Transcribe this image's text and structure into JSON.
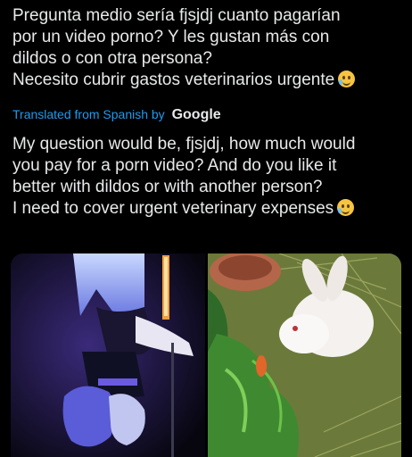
{
  "tweet": {
    "original_lines": [
      "Pregunta medio sería fjsjdj cuanto pagarían",
      "por un video porno? Y les gustan más con",
      "dildos o con otra persona?",
      "Necesito cubrir gastos veterinarios urgente"
    ],
    "translated_from": "Translated from Spanish by",
    "translator": "Google",
    "translation_lines": [
      "My question would be, fjsjdj, how much would",
      "you pay for a porn video? And do you like it",
      "better with dildos or with another person?",
      "I need to cover urgent veterinary expenses"
    ],
    "emoji": "smiling-face-with-tear-icon"
  },
  "media": {
    "photos": [
      {
        "name": "cosplay-photo"
      },
      {
        "name": "rabbit-photo"
      }
    ]
  },
  "colors": {
    "background": "#000000",
    "text": "#e7e9ea",
    "link": "#1d9bf0"
  }
}
